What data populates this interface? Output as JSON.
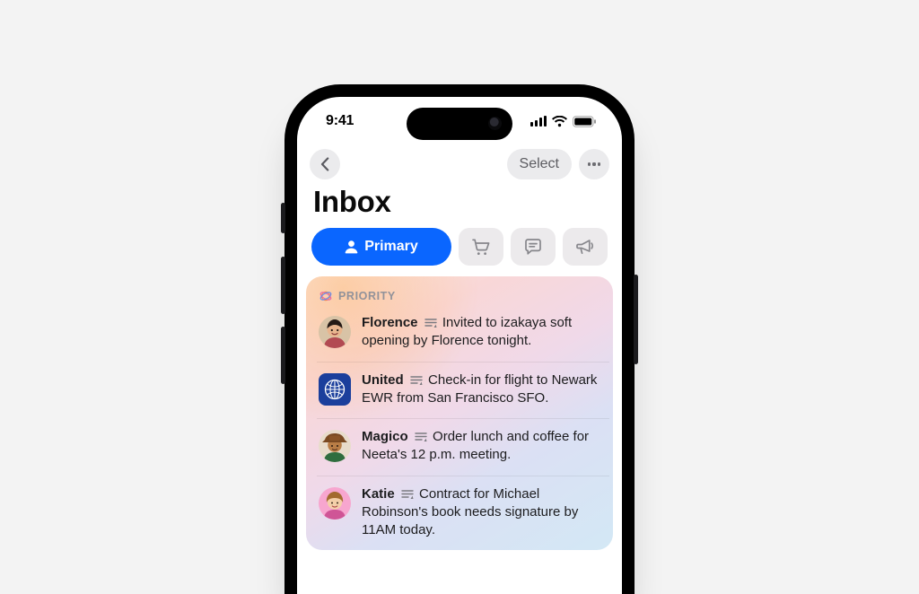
{
  "statusbar": {
    "time": "9:41"
  },
  "nav": {
    "select_label": "Select"
  },
  "page": {
    "title": "Inbox"
  },
  "categories": {
    "primary_label": "Primary"
  },
  "priority": {
    "label": "PRIORITY",
    "items": [
      {
        "sender": "Florence",
        "summary": "Invited to izakaya soft opening by Florence tonight.",
        "avatar_color": "#b07046",
        "avatar_shape": "round",
        "avatar_kind": "person-1"
      },
      {
        "sender": "United",
        "summary": "Check-in for flight to Newark EWR from San Francisco SFO.",
        "avatar_color": "#1b3f9c",
        "avatar_shape": "square",
        "avatar_kind": "globe"
      },
      {
        "sender": "Magico",
        "summary": "Order lunch and coffee for Neeta's 12 p.m. meeting.",
        "avatar_color": "#c77a2a",
        "avatar_shape": "round",
        "avatar_kind": "person-2"
      },
      {
        "sender": "Katie",
        "summary": "Contract for Michael Robinson's book needs signature by 11AM today.",
        "avatar_color": "#f7a6cf",
        "avatar_shape": "round",
        "avatar_kind": "person-3"
      }
    ]
  }
}
